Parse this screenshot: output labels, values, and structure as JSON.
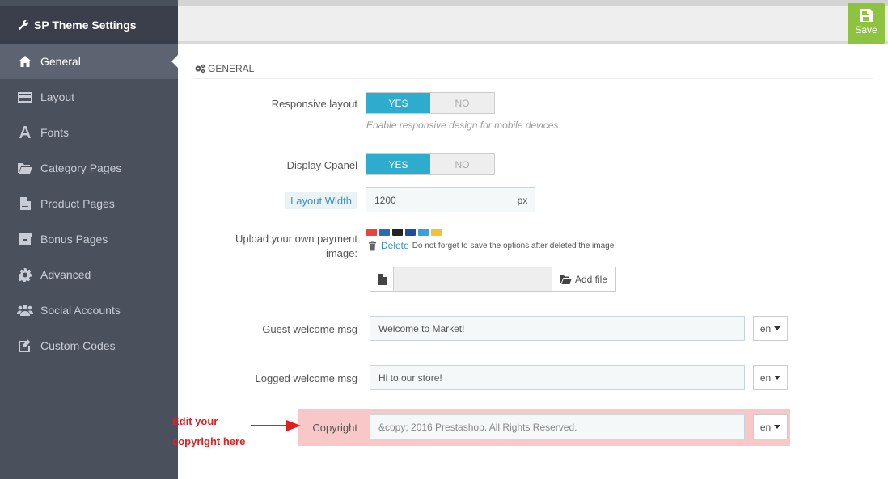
{
  "app": {
    "title": "SP Theme Settings",
    "icon": "wrench-icon"
  },
  "sidebar": {
    "items": [
      {
        "label": "General",
        "icon": "home-icon",
        "active": true
      },
      {
        "label": "Layout",
        "icon": "credit-card-icon"
      },
      {
        "label": "Fonts",
        "icon": "font-icon"
      },
      {
        "label": "Category Pages",
        "icon": "folder-open-icon"
      },
      {
        "label": "Product Pages",
        "icon": "file-icon"
      },
      {
        "label": "Bonus Pages",
        "icon": "archive-icon"
      },
      {
        "label": "Advanced",
        "icon": "gear-icon"
      },
      {
        "label": "Social Accounts",
        "icon": "users-icon"
      },
      {
        "label": "Custom Codes",
        "icon": "edit-icon"
      }
    ]
  },
  "toolbar": {
    "save_label": "Save",
    "save_icon": "floppy-disk-icon"
  },
  "section": {
    "title": "GENERAL",
    "icon": "gears-icon"
  },
  "form": {
    "responsive": {
      "label": "Responsive layout",
      "yes": "YES",
      "no": "NO",
      "value": "YES",
      "hint": "Enable responsive design for mobile devices"
    },
    "cpanel": {
      "label": "Display Cpanel",
      "yes": "YES",
      "no": "NO",
      "value": "YES"
    },
    "layout_width": {
      "label": "Layout Width",
      "value": "1200",
      "unit": "px"
    },
    "payment": {
      "label_line1": "Upload your own payment",
      "label_line2": "image:",
      "delete_label": "Delete",
      "delete_note": "Do not forget to save the options after deleted the image!",
      "add_file_label": "Add file",
      "card_colors": [
        "#e8443a",
        "#2b6cb5",
        "#222222",
        "#1a4fa0",
        "#3aa0d8",
        "#f2c230"
      ]
    },
    "guest_msg": {
      "label": "Guest welcome msg",
      "value": "Welcome to Market!",
      "lang": "en"
    },
    "logged_msg": {
      "label": "Logged welcome msg",
      "value": "Hi to our store!",
      "lang": "en"
    },
    "copyright": {
      "label": "Copyright",
      "value": "&copy; 2016 Prestashop. All Rights Reserved.",
      "lang": "en"
    }
  },
  "annotation": {
    "line1": "Edit your",
    "line2": "copyright here",
    "color": "#e02020"
  },
  "colors": {
    "sidebar_bg": "#4b505d",
    "sidebar_title_bg": "#3a3f4b",
    "toggle_on": "#2eacce",
    "save_bg": "#8dc33f",
    "highlight": "#f8c7c7"
  }
}
